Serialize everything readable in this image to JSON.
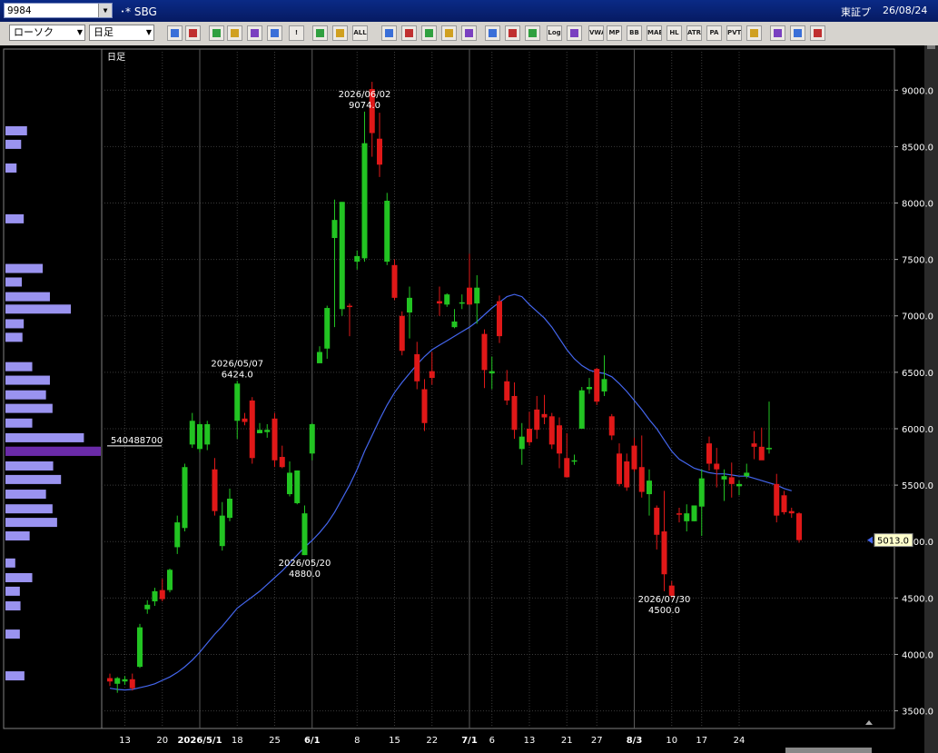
{
  "window": {
    "symbol_code": "9984",
    "ticker_name": "SBG",
    "market": "東証プ",
    "date": "26/08/24"
  },
  "toolbar": {
    "chart_type": "ローソク",
    "period": "日足",
    "buttons": [
      {
        "name": "zoom-icon",
        "label": ""
      },
      {
        "name": "split-icon",
        "label": ""
      },
      {
        "name": "hand-icon",
        "label": ""
      },
      {
        "name": "search-icon",
        "label": ""
      },
      {
        "name": "grid-icon",
        "label": ""
      },
      {
        "name": "crosshair-icon",
        "label": ""
      },
      {
        "name": "alert-icon",
        "label": "!"
      },
      {
        "name": "candle-left-icon",
        "label": ""
      },
      {
        "name": "candle-right-icon",
        "label": ""
      },
      {
        "name": "all-button",
        "label": "ALL"
      },
      {
        "name": "pen-icon",
        "label": ""
      },
      {
        "name": "cursor-icon",
        "label": ""
      },
      {
        "name": "arrow-icon",
        "label": ""
      },
      {
        "name": "note-icon",
        "label": ""
      },
      {
        "name": "trash-icon",
        "label": ""
      },
      {
        "name": "gear-icon",
        "label": ""
      },
      {
        "name": "wrench-icon",
        "label": ""
      },
      {
        "name": "palette-icon",
        "label": ""
      },
      {
        "name": "log-button",
        "label": "Log"
      },
      {
        "name": "list-icon",
        "label": ""
      },
      {
        "name": "vwap-button",
        "label": "VWAP"
      },
      {
        "name": "mp-button",
        "label": "MP"
      },
      {
        "name": "bb-button",
        "label": "BB"
      },
      {
        "name": "mae-button",
        "label": "MAE"
      },
      {
        "name": "hl-button",
        "label": "HL"
      },
      {
        "name": "atr-button",
        "label": "ATR"
      },
      {
        "name": "para-button",
        "label": "PA RA"
      },
      {
        "name": "pvt-button",
        "label": "PVT"
      },
      {
        "name": "frame-icon",
        "label": ""
      },
      {
        "name": "layout-icon",
        "label": ""
      },
      {
        "name": "menu-icon",
        "label": ""
      },
      {
        "name": "window-icon",
        "label": ""
      }
    ]
  },
  "chart_data": {
    "type": "candlestick",
    "title": "日足",
    "ylim": [
      3400,
      9300
    ],
    "yticks": [
      3500,
      4000,
      4500,
      5000,
      5500,
      6000,
      6500,
      7000,
      7500,
      8000,
      8500,
      9000
    ],
    "ytick_labels": [
      "3500.0",
      "4000.0",
      "4500.0",
      "5000.0",
      "5500.0",
      "6000.0",
      "6500.0",
      "7000.0",
      "7500.0",
      "8000.0",
      "8500.0",
      "9000.0"
    ],
    "xticks": [
      {
        "i": 2,
        "label": "13",
        "bold": false
      },
      {
        "i": 7,
        "label": "20",
        "bold": false
      },
      {
        "i": 12,
        "label": "2026/5/1",
        "bold": true
      },
      {
        "i": 17,
        "label": "18",
        "bold": false
      },
      {
        "i": 22,
        "label": "25",
        "bold": false
      },
      {
        "i": 27,
        "label": "6/1",
        "bold": true
      },
      {
        "i": 33,
        "label": "8",
        "bold": false
      },
      {
        "i": 38,
        "label": "15",
        "bold": false
      },
      {
        "i": 43,
        "label": "22",
        "bold": false
      },
      {
        "i": 48,
        "label": "7/1",
        "bold": true
      },
      {
        "i": 51,
        "label": "6",
        "bold": false
      },
      {
        "i": 56,
        "label": "13",
        "bold": false
      },
      {
        "i": 61,
        "label": "21",
        "bold": false
      },
      {
        "i": 65,
        "label": "27",
        "bold": false
      },
      {
        "i": 70,
        "label": "8/3",
        "bold": true
      },
      {
        "i": 75,
        "label": "10",
        "bold": false
      },
      {
        "i": 79,
        "label": "17",
        "bold": false
      },
      {
        "i": 84,
        "label": "24",
        "bold": false
      }
    ],
    "candles": [
      {
        "o": 3790,
        "h": 3830,
        "l": 3720,
        "c": 3760
      },
      {
        "o": 3740,
        "h": 3800,
        "l": 3660,
        "c": 3790
      },
      {
        "o": 3760,
        "h": 3810,
        "l": 3730,
        "c": 3780
      },
      {
        "o": 3780,
        "h": 3830,
        "l": 3680,
        "c": 3700
      },
      {
        "o": 3890,
        "h": 4270,
        "l": 3880,
        "c": 4240
      },
      {
        "o": 4400,
        "h": 4480,
        "l": 4360,
        "c": 4440
      },
      {
        "o": 4470,
        "h": 4590,
        "l": 4430,
        "c": 4560
      },
      {
        "o": 4570,
        "h": 4670,
        "l": 4470,
        "c": 4490
      },
      {
        "o": 4570,
        "h": 4760,
        "l": 4550,
        "c": 4750
      },
      {
        "o": 4950,
        "h": 5230,
        "l": 4890,
        "c": 5170
      },
      {
        "o": 5120,
        "h": 5690,
        "l": 5090,
        "c": 5660
      },
      {
        "o": 5860,
        "h": 6140,
        "l": 5830,
        "c": 6070
      },
      {
        "o": 5820,
        "h": 6060,
        "l": 5790,
        "c": 6040
      },
      {
        "o": 5860,
        "h": 6070,
        "l": 5810,
        "c": 6040
      },
      {
        "o": 5640,
        "h": 5740,
        "l": 5230,
        "c": 5270
      },
      {
        "o": 4960,
        "h": 5350,
        "l": 4920,
        "c": 5230
      },
      {
        "o": 5210,
        "h": 5470,
        "l": 5180,
        "c": 5380
      },
      {
        "o": 6070,
        "h": 6424,
        "l": 5910,
        "c": 6400
      },
      {
        "o": 6090,
        "h": 6140,
        "l": 6030,
        "c": 6060
      },
      {
        "o": 6250,
        "h": 6280,
        "l": 5690,
        "c": 5740
      },
      {
        "o": 5960,
        "h": 6050,
        "l": 5960,
        "c": 5990
      },
      {
        "o": 5970,
        "h": 6040,
        "l": 5920,
        "c": 5990
      },
      {
        "o": 6090,
        "h": 6140,
        "l": 5660,
        "c": 5720
      },
      {
        "o": 5750,
        "h": 5850,
        "l": 5650,
        "c": 5660
      },
      {
        "o": 5420,
        "h": 5710,
        "l": 5400,
        "c": 5610
      },
      {
        "o": 5340,
        "h": 5630,
        "l": 5330,
        "c": 5630
      },
      {
        "o": 4880,
        "h": 5320,
        "l": 4880,
        "c": 5250
      },
      {
        "o": 5780,
        "h": 6050,
        "l": 5720,
        "c": 6040
      },
      {
        "o": 6580,
        "h": 6730,
        "l": 6640,
        "c": 6680
      },
      {
        "o": 6710,
        "h": 7090,
        "l": 6620,
        "c": 7070
      },
      {
        "o": 7690,
        "h": 8030,
        "l": 6900,
        "c": 7850
      },
      {
        "o": 7060,
        "h": 8010,
        "l": 7000,
        "c": 8010
      },
      {
        "o": 7090,
        "h": 7110,
        "l": 6820,
        "c": 7080
      },
      {
        "o": 7480,
        "h": 7580,
        "l": 7410,
        "c": 7530
      },
      {
        "o": 7510,
        "h": 8810,
        "l": 7480,
        "c": 8530
      },
      {
        "o": 9010,
        "h": 9074,
        "l": 8410,
        "c": 8620
      },
      {
        "o": 8570,
        "h": 8800,
        "l": 8230,
        "c": 8340
      },
      {
        "o": 7480,
        "h": 8090,
        "l": 7450,
        "c": 8020
      },
      {
        "o": 7450,
        "h": 7500,
        "l": 7140,
        "c": 7160
      },
      {
        "o": 7000,
        "h": 7040,
        "l": 6650,
        "c": 6690
      },
      {
        "o": 7030,
        "h": 7260,
        "l": 6800,
        "c": 7160
      },
      {
        "o": 6660,
        "h": 6770,
        "l": 6350,
        "c": 6420
      },
      {
        "o": 6350,
        "h": 6440,
        "l": 5980,
        "c": 6050
      },
      {
        "o": 6510,
        "h": 6680,
        "l": 6390,
        "c": 6450
      },
      {
        "o": 7130,
        "h": 7260,
        "l": 7000,
        "c": 7110
      },
      {
        "o": 7100,
        "h": 7200,
        "l": 7080,
        "c": 7190
      },
      {
        "o": 6900,
        "h": 7060,
        "l": 6890,
        "c": 6950
      },
      {
        "o": 7120,
        "h": 7190,
        "l": 7060,
        "c": 7120
      },
      {
        "o": 7250,
        "h": 7550,
        "l": 7150,
        "c": 7100
      },
      {
        "o": 7110,
        "h": 7360,
        "l": 6930,
        "c": 7250
      },
      {
        "o": 6840,
        "h": 6880,
        "l": 6360,
        "c": 6520
      },
      {
        "o": 6490,
        "h": 6640,
        "l": 6350,
        "c": 6510
      },
      {
        "o": 7130,
        "h": 7180,
        "l": 6760,
        "c": 6820
      },
      {
        "o": 6420,
        "h": 6520,
        "l": 6210,
        "c": 6250
      },
      {
        "o": 6290,
        "h": 6410,
        "l": 5910,
        "c": 5990
      },
      {
        "o": 5820,
        "h": 6050,
        "l": 5680,
        "c": 5930
      },
      {
        "o": 6000,
        "h": 6150,
        "l": 5850,
        "c": 5880
      },
      {
        "o": 6170,
        "h": 6290,
        "l": 5910,
        "c": 5990
      },
      {
        "o": 6130,
        "h": 6300,
        "l": 6040,
        "c": 6100
      },
      {
        "o": 6110,
        "h": 6140,
        "l": 5820,
        "c": 5860
      },
      {
        "o": 6030,
        "h": 6100,
        "l": 5650,
        "c": 5780
      },
      {
        "o": 5740,
        "h": 5960,
        "l": 5570,
        "c": 5570
      },
      {
        "o": 5720,
        "h": 5770,
        "l": 5680,
        "c": 5720
      },
      {
        "o": 6000,
        "h": 6370,
        "l": 6000,
        "c": 6340
      },
      {
        "o": 6350,
        "h": 6450,
        "l": 6310,
        "c": 6370
      },
      {
        "o": 6530,
        "h": 6540,
        "l": 6210,
        "c": 6240
      },
      {
        "o": 6330,
        "h": 6650,
        "l": 6290,
        "c": 6440
      },
      {
        "o": 6110,
        "h": 6130,
        "l": 5900,
        "c": 5940
      },
      {
        "o": 5780,
        "h": 5870,
        "l": 5490,
        "c": 5510
      },
      {
        "o": 5710,
        "h": 5780,
        "l": 5450,
        "c": 5480
      },
      {
        "o": 5850,
        "h": 5920,
        "l": 5620,
        "c": 5640
      },
      {
        "o": 5660,
        "h": 5940,
        "l": 5390,
        "c": 5440
      },
      {
        "o": 5420,
        "h": 5640,
        "l": 5230,
        "c": 5540
      },
      {
        "o": 5300,
        "h": 5320,
        "l": 4930,
        "c": 5060
      },
      {
        "o": 5090,
        "h": 5450,
        "l": 4560,
        "c": 4710
      },
      {
        "o": 4610,
        "h": 4650,
        "l": 4500,
        "c": 4520
      },
      {
        "o": 5250,
        "h": 5300,
        "l": 5170,
        "c": 5240
      },
      {
        "o": 5180,
        "h": 5330,
        "l": 5090,
        "c": 5250
      },
      {
        "o": 5180,
        "h": 5320,
        "l": 5180,
        "c": 5320
      },
      {
        "o": 5310,
        "h": 5640,
        "l": 5050,
        "c": 5560
      },
      {
        "o": 5870,
        "h": 5930,
        "l": 5630,
        "c": 5690
      },
      {
        "o": 5690,
        "h": 5830,
        "l": 5480,
        "c": 5640
      },
      {
        "o": 5550,
        "h": 5640,
        "l": 5360,
        "c": 5580
      },
      {
        "o": 5570,
        "h": 5700,
        "l": 5390,
        "c": 5510
      },
      {
        "o": 5490,
        "h": 5540,
        "l": 5410,
        "c": 5510
      },
      {
        "o": 5580,
        "h": 5690,
        "l": 5560,
        "c": 5610
      },
      {
        "o": 5870,
        "h": 5980,
        "l": 5730,
        "c": 5840
      },
      {
        "o": 5840,
        "h": 6010,
        "l": 5750,
        "c": 5720
      },
      {
        "o": 5820,
        "h": 6240,
        "l": 5780,
        "c": 5830
      },
      {
        "o": 5510,
        "h": 5600,
        "l": 5170,
        "c": 5230
      },
      {
        "o": 5410,
        "h": 5450,
        "l": 5240,
        "c": 5260
      },
      {
        "o": 5270,
        "h": 5300,
        "l": 5210,
        "c": 5250
      },
      {
        "o": 5250,
        "h": 5260,
        "l": 4990,
        "c": 5013
      }
    ],
    "ma": [
      3700,
      3690,
      3685,
      3690,
      3705,
      3720,
      3740,
      3770,
      3800,
      3840,
      3890,
      3950,
      4020,
      4100,
      4180,
      4250,
      4330,
      4410,
      4460,
      4510,
      4560,
      4620,
      4680,
      4740,
      4810,
      4880,
      4950,
      5010,
      5080,
      5160,
      5260,
      5380,
      5500,
      5640,
      5800,
      5940,
      6080,
      6210,
      6320,
      6410,
      6490,
      6570,
      6640,
      6700,
      6740,
      6780,
      6820,
      6860,
      6900,
      6950,
      7010,
      7070,
      7120,
      7170,
      7190,
      7170,
      7100,
      7040,
      6980,
      6900,
      6800,
      6700,
      6620,
      6560,
      6520,
      6500,
      6490,
      6460,
      6400,
      6330,
      6250,
      6170,
      6080,
      6000,
      5900,
      5800,
      5730,
      5690,
      5650,
      5630,
      5610,
      5600,
      5600,
      5590,
      5580,
      5580,
      5560,
      5540,
      5520,
      5500,
      5470,
      5450
    ],
    "annotations": [
      {
        "i": 34,
        "date": "2026/06/02",
        "value": "9074.0",
        "pos": "above"
      },
      {
        "i": 17,
        "date": "2026/05/07",
        "value": "6424.0",
        "pos": "above"
      },
      {
        "i": 26,
        "date": "2026/05/20",
        "value": "4880.0",
        "pos": "below"
      },
      {
        "i": 74,
        "date": "2026/07/30",
        "value": "4500.0",
        "pos": "below"
      }
    ],
    "last_price": "5013.0",
    "volume_profile": {
      "max_label": "540488700",
      "bars": [
        {
          "p": 8640,
          "v": 0.33
        },
        {
          "p": 8520,
          "v": 0.24
        },
        {
          "p": 8310,
          "v": 0.17
        },
        {
          "p": 7860,
          "v": 0.28
        },
        {
          "p": 7420,
          "v": 0.57
        },
        {
          "p": 7300,
          "v": 0.25
        },
        {
          "p": 7170,
          "v": 0.68
        },
        {
          "p": 7060,
          "v": 1.0
        },
        {
          "p": 6930,
          "v": 0.28
        },
        {
          "p": 6810,
          "v": 0.26
        },
        {
          "p": 6550,
          "v": 0.41
        },
        {
          "p": 6430,
          "v": 0.68
        },
        {
          "p": 6300,
          "v": 0.62
        },
        {
          "p": 6180,
          "v": 0.72
        },
        {
          "p": 6050,
          "v": 0.41
        },
        {
          "p": 5920,
          "v": 1.2
        },
        {
          "p": 5800,
          "v": 1.45
        },
        {
          "p": 5670,
          "v": 0.73
        },
        {
          "p": 5550,
          "v": 0.85
        },
        {
          "p": 5420,
          "v": 0.62
        },
        {
          "p": 5290,
          "v": 0.72
        },
        {
          "p": 5170,
          "v": 0.79
        },
        {
          "p": 5050,
          "v": 0.37
        },
        {
          "p": 4810,
          "v": 0.15
        },
        {
          "p": 4680,
          "v": 0.41
        },
        {
          "p": 4560,
          "v": 0.22
        },
        {
          "p": 4430,
          "v": 0.23
        },
        {
          "p": 4180,
          "v": 0.22
        },
        {
          "p": 3810,
          "v": 0.29
        }
      ]
    }
  }
}
